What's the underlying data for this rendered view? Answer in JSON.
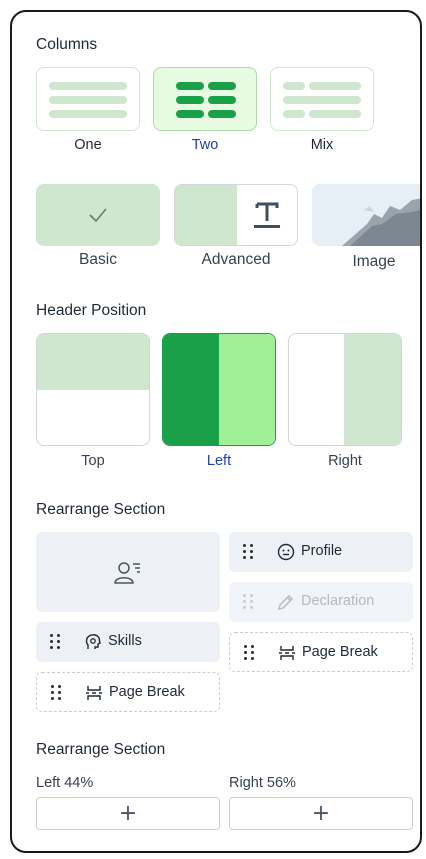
{
  "columns": {
    "title": "Columns",
    "options": [
      {
        "label": "One",
        "selected": false
      },
      {
        "label": "Two",
        "selected": true
      },
      {
        "label": "Mix",
        "selected": false
      }
    ]
  },
  "styles": [
    {
      "label": "Basic",
      "icon": "check-icon"
    },
    {
      "label": "Advanced",
      "icon": "text-t-icon"
    },
    {
      "label": "Image",
      "icon": "mountain-image"
    }
  ],
  "header_position": {
    "title": "Header Position",
    "options": [
      {
        "label": "Top",
        "selected": false
      },
      {
        "label": "Left",
        "selected": true
      },
      {
        "label": "Right",
        "selected": false
      }
    ]
  },
  "rearrange": {
    "title": "Rearrange Section",
    "left_items": [
      {
        "label": "Skills",
        "icon": "head-gear-icon"
      },
      {
        "label": "Page Break",
        "icon": "page-break-icon"
      }
    ],
    "right_items": [
      {
        "label": "Profile",
        "icon": "face-icon"
      },
      {
        "label": "Declaration",
        "icon": "pencil-icon",
        "disabled": true
      },
      {
        "label": "Page Break",
        "icon": "page-break-icon"
      }
    ]
  },
  "rearrange2": {
    "title": "Rearrange Section",
    "left_label": "Left 44%",
    "right_label": "Right 56%",
    "add_symbol": "+"
  },
  "colors": {
    "accent_green": "#1ba04a",
    "light_green": "#cfe6cf",
    "selected_text": "#1e40af"
  }
}
